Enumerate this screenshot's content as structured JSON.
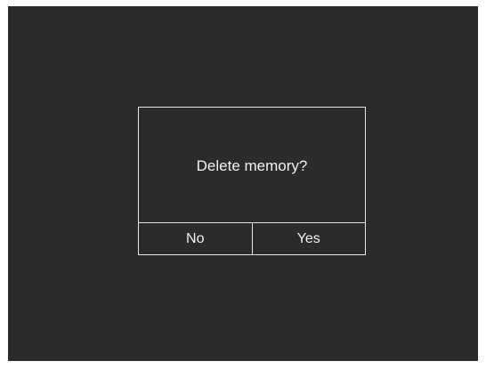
{
  "dialog": {
    "message": "Delete memory?",
    "no_label": "No",
    "yes_label": "Yes"
  },
  "colors": {
    "screen_background": "#2c2b29",
    "border": "#e8e8e8",
    "text": "#f2f2f2"
  }
}
